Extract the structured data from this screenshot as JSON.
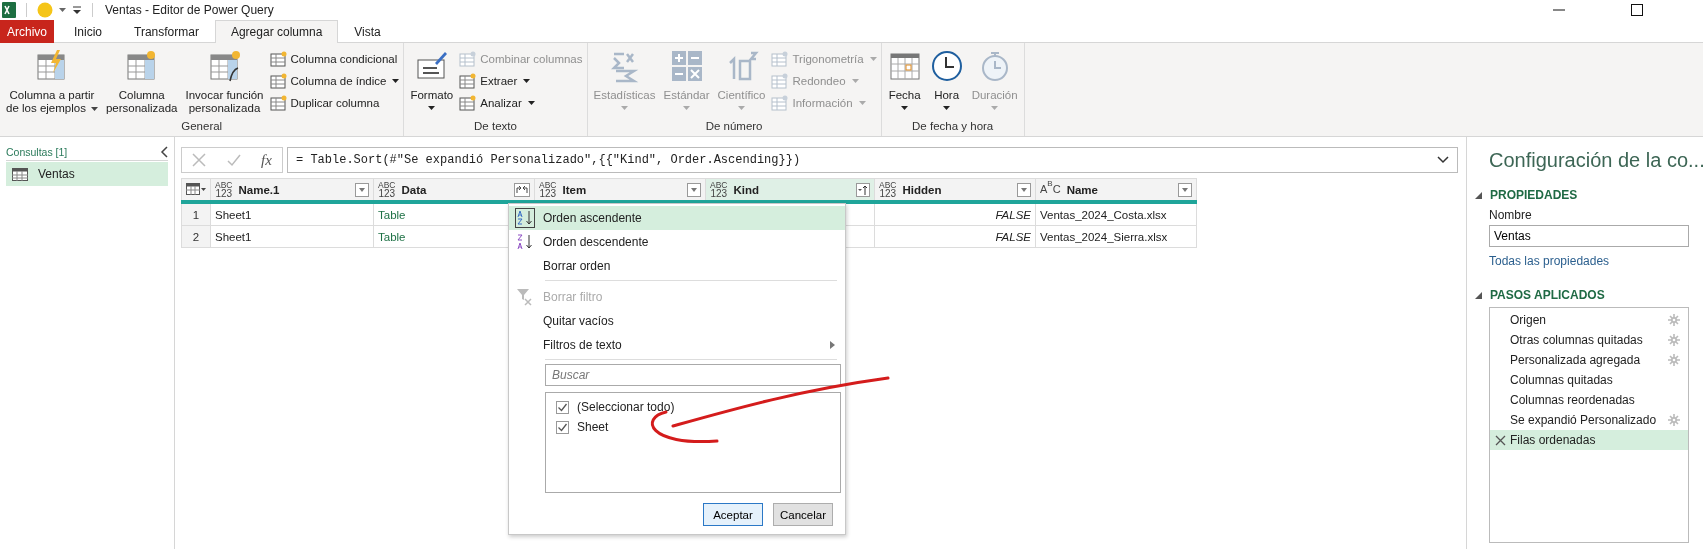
{
  "window": {
    "title": "Ventas - Editor de Power Query"
  },
  "tabs": [
    {
      "label": "Archivo",
      "kind": "file",
      "selected": false
    },
    {
      "label": "Inicio",
      "kind": "tab",
      "selected": false
    },
    {
      "label": "Transformar",
      "kind": "tab",
      "selected": false
    },
    {
      "label": "Agregar columna",
      "kind": "tab",
      "selected": true
    },
    {
      "label": "Vista",
      "kind": "tab",
      "selected": false
    }
  ],
  "ribbon": {
    "groups": [
      {
        "label": "General",
        "items": [
          {
            "kind": "large",
            "lines": [
              "Columna a partir",
              "de los ejemplos"
            ],
            "dropdown": true,
            "disabled": false
          },
          {
            "kind": "large",
            "lines": [
              "Columna",
              "personalizada"
            ],
            "dropdown": false,
            "disabled": false
          },
          {
            "kind": "large",
            "lines": [
              "Invocar función",
              "personalizada"
            ],
            "dropdown": false,
            "disabled": false
          },
          {
            "kind": "small",
            "label": "Columna condicional",
            "dropdown": false,
            "disabled": false
          },
          {
            "kind": "small",
            "label": "Columna de índice",
            "dropdown": true,
            "disabled": false
          },
          {
            "kind": "small",
            "label": "Duplicar columna",
            "dropdown": false,
            "disabled": false
          }
        ]
      },
      {
        "label": "De texto",
        "items": [
          {
            "kind": "large",
            "lines": [
              "Formato"
            ],
            "dropdown": true,
            "disabled": false
          },
          {
            "kind": "small",
            "label": "Combinar columnas",
            "dropdown": false,
            "disabled": true
          },
          {
            "kind": "small",
            "label": "Extraer",
            "dropdown": true,
            "disabled": false
          },
          {
            "kind": "small",
            "label": "Analizar",
            "dropdown": true,
            "disabled": false
          }
        ]
      },
      {
        "label": "De número",
        "items": [
          {
            "kind": "large",
            "lines": [
              "Estadísticas"
            ],
            "dropdown": true,
            "disabled": true
          },
          {
            "kind": "large",
            "lines": [
              "Estándar"
            ],
            "dropdown": true,
            "disabled": true
          },
          {
            "kind": "large",
            "lines": [
              "Científico"
            ],
            "dropdown": true,
            "disabled": true
          },
          {
            "kind": "small",
            "label": "Trigonometría",
            "dropdown": true,
            "disabled": true
          },
          {
            "kind": "small",
            "label": "Redondeo",
            "dropdown": true,
            "disabled": true
          },
          {
            "kind": "small",
            "label": "Información",
            "dropdown": true,
            "disabled": true
          }
        ]
      },
      {
        "label": "De fecha y hora",
        "items": [
          {
            "kind": "large",
            "lines": [
              "Fecha"
            ],
            "dropdown": true,
            "disabled": false
          },
          {
            "kind": "large",
            "lines": [
              "Hora"
            ],
            "dropdown": true,
            "disabled": false
          },
          {
            "kind": "large",
            "lines": [
              "Duración"
            ],
            "dropdown": true,
            "disabled": true
          }
        ]
      }
    ]
  },
  "queries": {
    "header": "Consultas [1]",
    "items": [
      {
        "label": "Ventas",
        "selected": true
      }
    ]
  },
  "formula_bar": {
    "function_symbol": "fx",
    "formula": "= Table.Sort(#\"Se expandió Personalizado\",{{\"Kind\", Order.Ascending}})"
  },
  "table": {
    "columns": [
      {
        "name": "Name.1",
        "type_label": [
          "ABC",
          "123"
        ],
        "kind": "filter",
        "selected": false
      },
      {
        "name": "Data",
        "type_label": [
          "ABC",
          "123"
        ],
        "kind": "expand",
        "selected": false
      },
      {
        "name": "Item",
        "type_label": [
          "ABC",
          "123"
        ],
        "kind": "filter",
        "selected": false
      },
      {
        "name": "Kind",
        "type_label": [
          "ABC",
          "123"
        ],
        "kind": "sorted",
        "selected": true
      },
      {
        "name": "Hidden",
        "type_label": [
          "ABC",
          "123"
        ],
        "kind": "filter",
        "selected": false
      },
      {
        "name": "Name",
        "type_label": [
          "A",
          "B",
          "C"
        ],
        "kind": "filter",
        "selected": false
      }
    ],
    "rows": [
      {
        "number": "1",
        "name_1": "Sheet1",
        "data": "Table",
        "hidden": "FALSE",
        "name": "Ventas_2024_Costa.xlsx"
      },
      {
        "number": "2",
        "name_1": "Sheet1",
        "data": "Table",
        "hidden": "FALSE",
        "name": "Ventas_2024_Sierra.xlsx"
      }
    ]
  },
  "filter_menu": {
    "items": [
      {
        "kind": "sort_asc",
        "label": "Orden ascendente",
        "selected": true,
        "disabled": false
      },
      {
        "kind": "sort_desc",
        "label": "Orden descendente",
        "selected": false,
        "disabled": false
      },
      {
        "kind": "plain",
        "label": "Borrar orden",
        "selected": false,
        "disabled": false
      },
      {
        "kind": "separator"
      },
      {
        "kind": "clear_filter",
        "label": "Borrar filtro",
        "selected": false,
        "disabled": true
      },
      {
        "kind": "plain",
        "label": "Quitar vacíos",
        "selected": false,
        "disabled": false
      },
      {
        "kind": "submenu",
        "label": "Filtros de texto",
        "selected": false,
        "disabled": false
      },
      {
        "kind": "separator"
      }
    ],
    "search": {
      "placeholder": "Buscar"
    },
    "values": [
      {
        "label": "(Seleccionar todo)",
        "checked": true
      },
      {
        "label": "Sheet",
        "checked": true
      }
    ],
    "buttons": [
      {
        "label": "Aceptar",
        "primary": true
      },
      {
        "label": "Cancelar",
        "primary": false
      }
    ]
  },
  "settings_pane": {
    "title": "Configuración de la co...",
    "properties": {
      "header": "PROPIEDADES",
      "name_label": "Nombre",
      "name_value": "Ventas",
      "link": "Todas las propiedades"
    },
    "steps": {
      "header": "PASOS APLICADOS",
      "items": [
        {
          "label": "Origen",
          "has_settings": true,
          "selected": false
        },
        {
          "label": "Otras columnas quitadas",
          "has_settings": true,
          "selected": false
        },
        {
          "label": "Personalizada agregada",
          "has_settings": true,
          "selected": false
        },
        {
          "label": "Columnas quitadas",
          "has_settings": false,
          "selected": false
        },
        {
          "label": "Columnas reordenadas",
          "has_settings": false,
          "selected": false
        },
        {
          "label": "Se expandió Personalizado",
          "has_settings": true,
          "selected": false
        },
        {
          "label": "Filas ordenadas",
          "has_settings": false,
          "selected": true
        }
      ]
    }
  }
}
